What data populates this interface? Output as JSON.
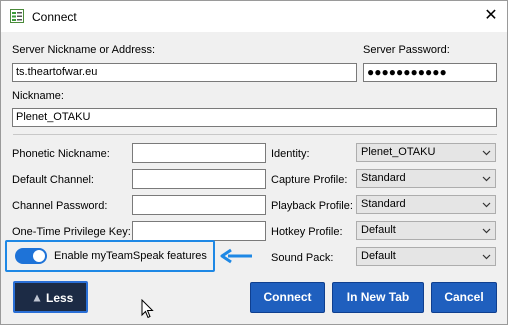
{
  "window": {
    "title": "Connect",
    "close_glyph": "✕"
  },
  "server": {
    "address_label": "Server Nickname or Address:",
    "address_value": "ts.theartofwar.eu",
    "password_label": "Server Password:",
    "password_value": "●●●●●●●●●●●"
  },
  "nickname": {
    "label": "Nickname:",
    "value": "Plenet_OTAKU"
  },
  "left_fields": [
    {
      "label": "Phonetic Nickname:",
      "value": ""
    },
    {
      "label": "Default Channel:",
      "value": ""
    },
    {
      "label": "Channel Password:",
      "value": ""
    },
    {
      "label": "One-Time Privilege Key:",
      "value": ""
    }
  ],
  "right_fields": [
    {
      "label": "Identity:",
      "value": "Plenet_OTAKU"
    },
    {
      "label": "Capture Profile:",
      "value": "Standard"
    },
    {
      "label": "Playback Profile:",
      "value": "Standard"
    },
    {
      "label": "Hotkey Profile:",
      "value": "Default"
    },
    {
      "label": "Sound Pack:",
      "value": "Default"
    }
  ],
  "toggle": {
    "label": "Enable myTeamSpeak features",
    "enabled": true
  },
  "buttons": {
    "less": "Less",
    "connect": "Connect",
    "new_tab": "In New Tab",
    "cancel": "Cancel"
  },
  "colors": {
    "accent": "#1f5fbe",
    "highlight": "#1e88e5",
    "less_bg": "#1c2b45"
  }
}
